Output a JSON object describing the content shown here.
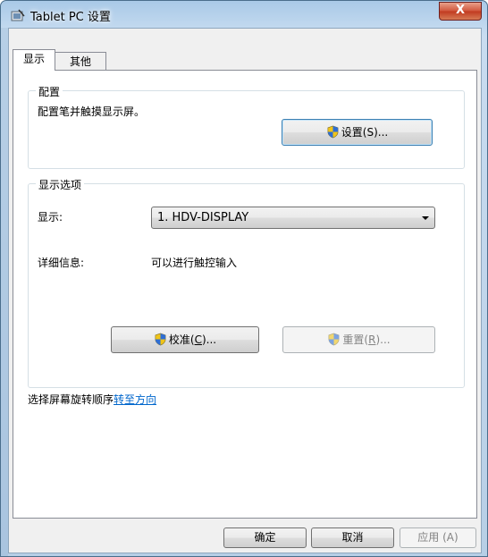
{
  "window": {
    "title": "Tablet PC 设置",
    "close_label": "X"
  },
  "tabs": [
    {
      "label": "显示",
      "active": true
    },
    {
      "label": "其他",
      "active": false
    }
  ],
  "config_group": {
    "title": "配置",
    "description": "配置笔并触摸显示屏。",
    "setup_button": {
      "label": "设置(S)..."
    }
  },
  "display_group": {
    "title": "显示选项",
    "display_label": "显示:",
    "display_value": "1. HDV-DISPLAY",
    "details_label": "详细信息:",
    "details_value": "可以进行触控输入",
    "calibrate_button": {
      "label_prefix": "校准(",
      "accel": "C",
      "label_suffix": ")..."
    },
    "reset_button": {
      "label_prefix": "重置(",
      "accel": "R",
      "label_suffix": ")...",
      "enabled": false
    }
  },
  "rotation": {
    "text": "选择屏幕旋转顺序",
    "link": "转至方向"
  },
  "footer": {
    "ok": "确定",
    "cancel": "取消",
    "apply": "应用 (A)"
  },
  "colors": {
    "link": "#0066cc",
    "close_button": "#c13a1f",
    "frame": "#b7cfe6"
  },
  "icons": {
    "app": "tablet-pc-icon",
    "shield": "uac-shield-icon"
  }
}
